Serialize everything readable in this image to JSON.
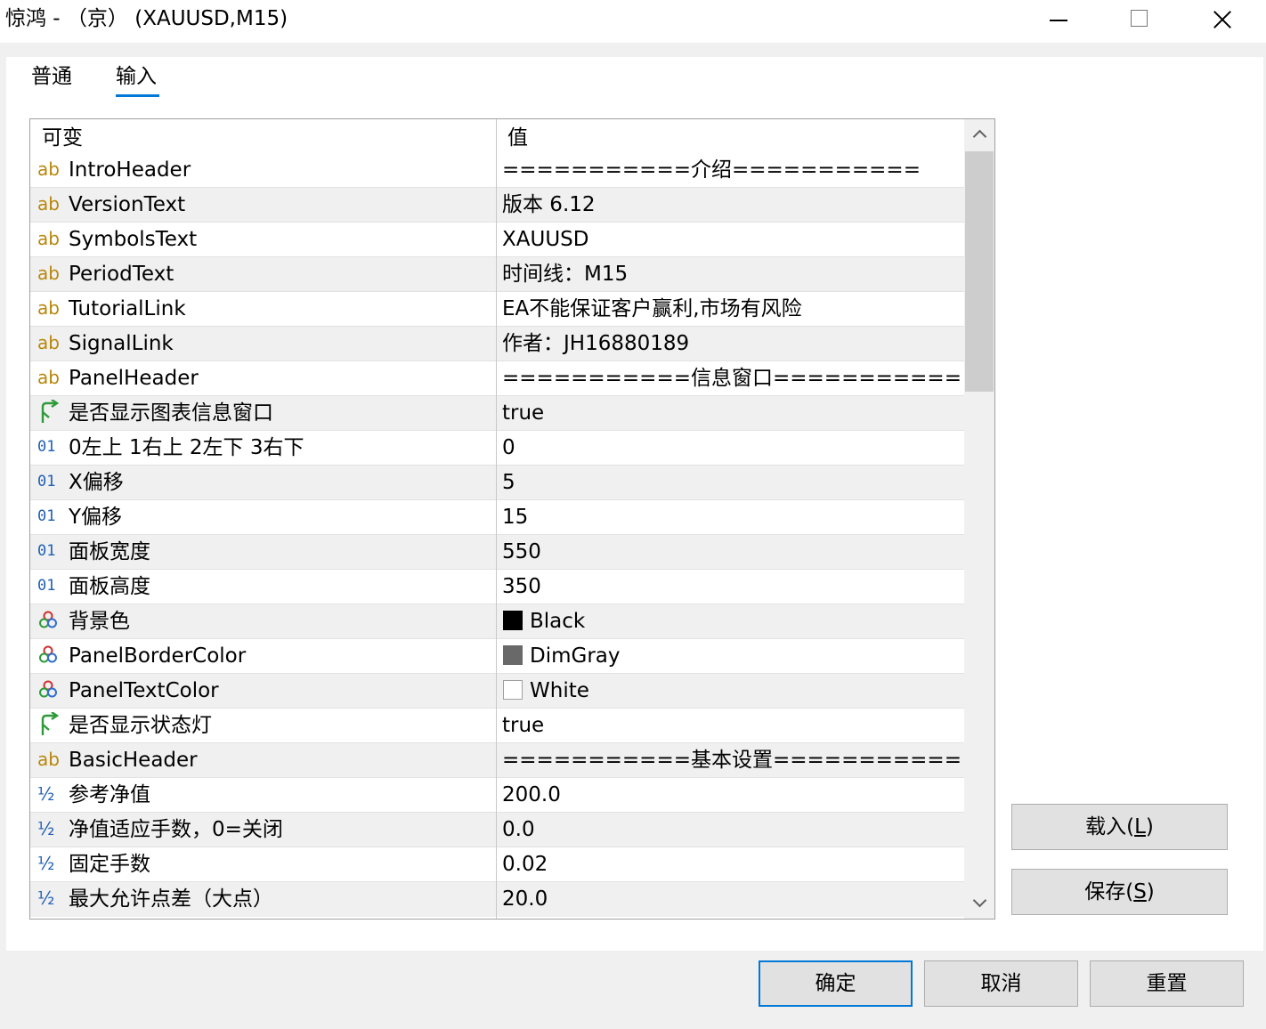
{
  "window": {
    "title": "惊鸿 - （京） (XAUUSD,M15)"
  },
  "tabs": [
    {
      "label": "普通",
      "active": false
    },
    {
      "label": "输入",
      "active": true
    }
  ],
  "grid": {
    "header_variable": "可变",
    "header_value": "值",
    "rows": [
      {
        "type": "string",
        "icon": "ab",
        "name": "IntroHeader",
        "value": "===========介绍==========="
      },
      {
        "type": "string",
        "icon": "ab",
        "name": "VersionText",
        "value": "版本 6.12"
      },
      {
        "type": "string",
        "icon": "ab",
        "name": "SymbolsText",
        "value": "XAUUSD"
      },
      {
        "type": "string",
        "icon": "ab",
        "name": "PeriodText",
        "value": "时间线：M15"
      },
      {
        "type": "string",
        "icon": "ab",
        "name": "TutorialLink",
        "value": "EA不能保证客户赢利,市场有风险"
      },
      {
        "type": "string",
        "icon": "ab",
        "name": "SignalLink",
        "value": "作者：JH16880189"
      },
      {
        "type": "string",
        "icon": "ab",
        "name": "PanelHeader",
        "value": "===========信息窗口==========="
      },
      {
        "type": "bool",
        "icon": "bool-arrow-icon",
        "name": "是否显示图表信息窗口",
        "value": "true"
      },
      {
        "type": "int",
        "icon": "01",
        "name": "0左上 1右上 2左下 3右下",
        "value": "0"
      },
      {
        "type": "int",
        "icon": "01",
        "name": "X偏移",
        "value": "5"
      },
      {
        "type": "int",
        "icon": "01",
        "name": "Y偏移",
        "value": "15"
      },
      {
        "type": "int",
        "icon": "01",
        "name": "面板宽度",
        "value": "550"
      },
      {
        "type": "int",
        "icon": "01",
        "name": "面板高度",
        "value": "350"
      },
      {
        "type": "color",
        "icon": "color-circles-icon",
        "name": "背景色",
        "value": "Black",
        "swatch": "#000000"
      },
      {
        "type": "color",
        "icon": "color-circles-icon",
        "name": "PanelBorderColor",
        "value": "DimGray",
        "swatch": "#696969"
      },
      {
        "type": "color",
        "icon": "color-circles-icon",
        "name": "PanelTextColor",
        "value": "White",
        "swatch": "#ffffff"
      },
      {
        "type": "bool",
        "icon": "bool-arrow-icon",
        "name": "是否显示状态灯",
        "value": "true"
      },
      {
        "type": "string",
        "icon": "ab",
        "name": "BasicHeader",
        "value": "===========基本设置==========="
      },
      {
        "type": "double",
        "icon": "½",
        "name": "参考净值",
        "value": "200.0"
      },
      {
        "type": "double",
        "icon": "½",
        "name": "净值适应手数，0=关闭",
        "value": "0.0"
      },
      {
        "type": "double",
        "icon": "½",
        "name": "固定手数",
        "value": "0.02"
      },
      {
        "type": "double",
        "icon": "½",
        "name": "最大允许点差（大点）",
        "value": "20.0"
      }
    ]
  },
  "buttons": {
    "load_label": "载入(",
    "load_key": "L",
    "load_close": ")",
    "save_label": "保存(",
    "save_key": "S",
    "save_close": ")",
    "ok": "确定",
    "cancel": "取消",
    "reset": "重置"
  },
  "colors": {
    "accent": "#0078d7",
    "string_icon": "#b8860b",
    "number_icon": "#1f5fb5",
    "bool_icon": "#2e9a3a"
  }
}
